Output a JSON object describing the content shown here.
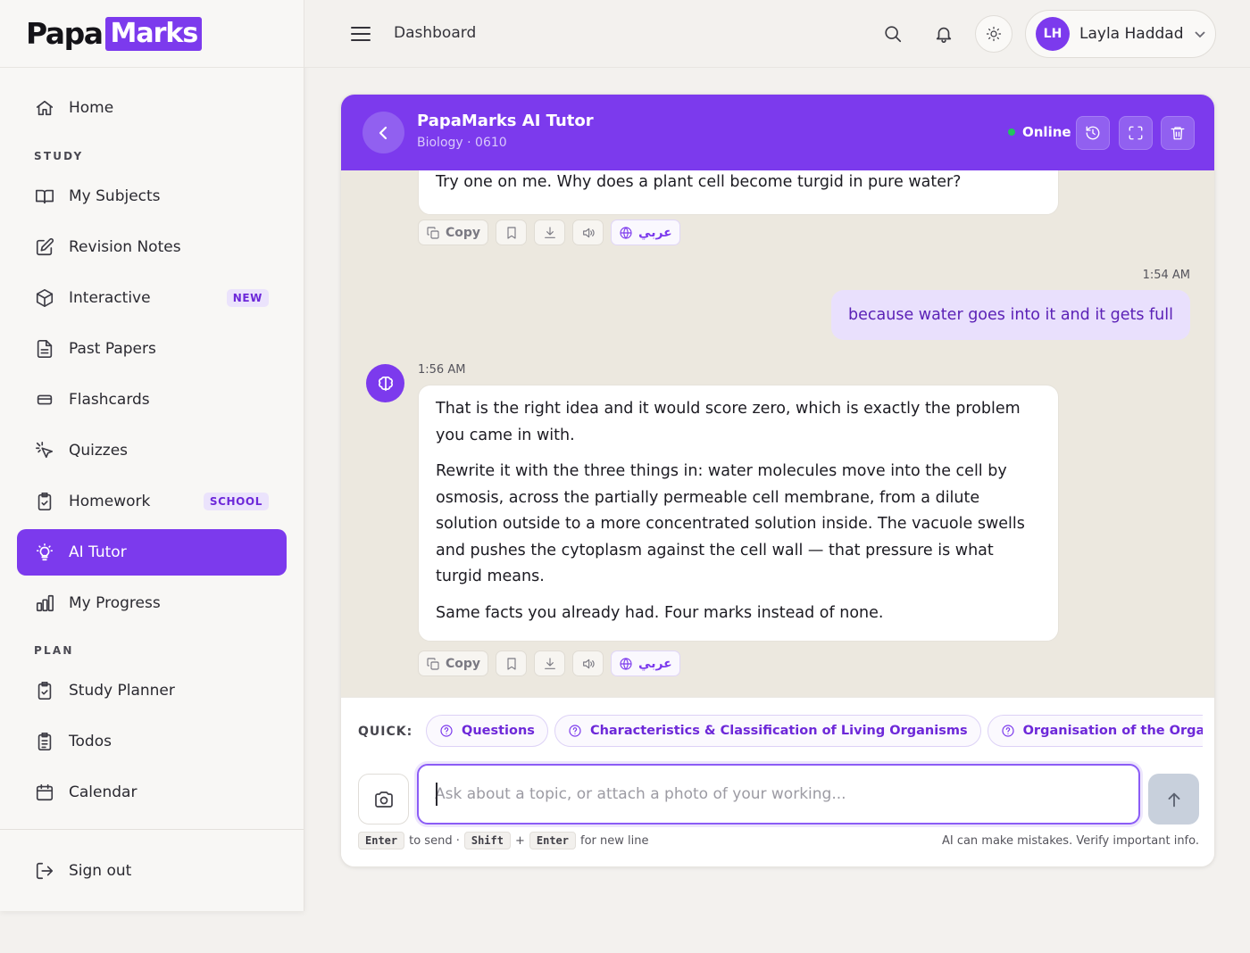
{
  "brand": {
    "part1": "Papa",
    "part2": "Marks",
    "accent": "#7c3aed"
  },
  "sidebar": {
    "items": [
      {
        "label": "Home",
        "icon": "home-icon"
      },
      {
        "label": "My Subjects",
        "icon": "book-open-icon"
      },
      {
        "label": "Revision Notes",
        "icon": "edit-icon"
      },
      {
        "label": "Interactive",
        "icon": "cube-icon",
        "badge": "NEW"
      },
      {
        "label": "Past Papers",
        "icon": "file-text-icon"
      },
      {
        "label": "Flashcards",
        "icon": "cards-icon"
      },
      {
        "label": "Quizzes",
        "icon": "cursor-click-icon"
      },
      {
        "label": "Homework",
        "icon": "clipboard-check-icon",
        "badge": "SCHOOL"
      },
      {
        "label": "AI Tutor",
        "icon": "lightbulb-icon",
        "active": true
      },
      {
        "label": "My Progress",
        "icon": "bar-chart-icon"
      },
      {
        "label": "Study Planner",
        "icon": "clipboard-check-icon"
      },
      {
        "label": "Todos",
        "icon": "clipboard-list-icon"
      },
      {
        "label": "Calendar",
        "icon": "calendar-icon"
      }
    ],
    "sections": {
      "study": "STUDY",
      "plan": "PLAN"
    },
    "signout": "Sign out"
  },
  "topbar": {
    "breadcrumb": "Dashboard",
    "user": {
      "initials": "LH",
      "name": "Layla Haddad"
    }
  },
  "chat": {
    "title": "PapaMarks AI Tutor",
    "subtitle": "Biology · 0610",
    "status": "Online",
    "messages": {
      "ai_prev_text": "Try one on me. Why does a plant cell become turgid in pure water?",
      "user_time": "1:54 AM",
      "user_text": "because water goes into it and it gets full",
      "ai_time": "1:56 AM",
      "ai_paragraphs": [
        "That is the right idea and it would score zero, which is exactly the problem you came in with.",
        "Rewrite it with the three things in: water molecules move into the cell by osmosis, across the partially permeable cell membrane, from a dilute solution outside to a more concentrated solution inside. The vacuole swells and pushes the cytoplasm against the cell wall — that pressure is what turgid means.",
        "Same facts you already had. Four marks instead of none."
      ]
    },
    "actions": {
      "copy": "Copy",
      "translate": "عربي"
    },
    "quick": {
      "label": "QUICK:",
      "chips": [
        "Questions",
        "Characteristics & Classification of Living Organisms",
        "Organisation of the Organism"
      ]
    },
    "input": {
      "placeholder": "Ask about a topic, or attach a photo of your working..."
    },
    "hint": {
      "enter": "Enter",
      "to_send": "to send ·",
      "shift": "Shift",
      "plus": "+",
      "enter2": "Enter",
      "new_line": "for new line"
    },
    "disclaimer": "AI can make mistakes. Verify important info."
  }
}
